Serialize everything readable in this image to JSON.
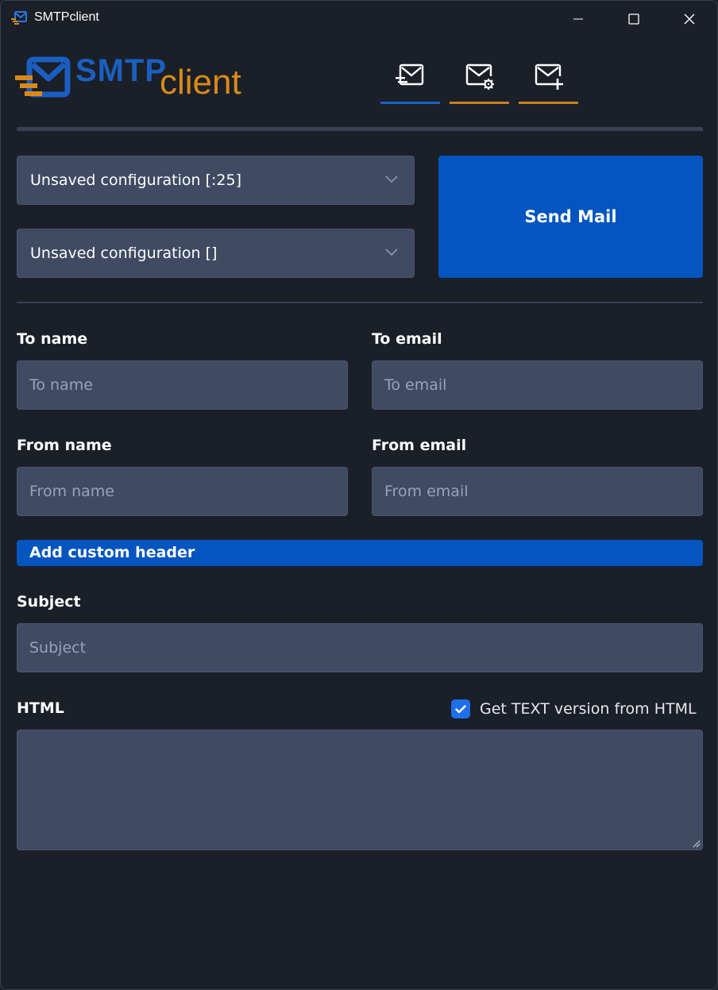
{
  "window": {
    "title": "SMTPclient"
  },
  "logo": {
    "part1": "SMTP",
    "part2": "client"
  },
  "nav": [
    {
      "name": "send-mail-icon",
      "active": true
    },
    {
      "name": "mail-settings-icon",
      "active": false
    },
    {
      "name": "mail-add-icon",
      "active": false
    }
  ],
  "config": {
    "select1": "Unsaved configuration [:25]",
    "select2": "Unsaved configuration []"
  },
  "actions": {
    "send_label": "Send Mail",
    "custom_header_label": "Add custom header"
  },
  "fields": {
    "to_name": {
      "label": "To name",
      "placeholder": "To name",
      "value": ""
    },
    "to_email": {
      "label": "To email",
      "placeholder": "To email",
      "value": ""
    },
    "from_name": {
      "label": "From name",
      "placeholder": "From name",
      "value": ""
    },
    "from_email": {
      "label": "From email",
      "placeholder": "From email",
      "value": ""
    },
    "subject": {
      "label": "Subject",
      "placeholder": "Subject",
      "value": ""
    },
    "html": {
      "label": "HTML",
      "value": ""
    }
  },
  "text_version": {
    "label": "Get TEXT version from HTML",
    "checked": true
  },
  "colors": {
    "background": "#1b1f28",
    "field": "#404a62",
    "accent_blue": "#0455bf",
    "accent_orange": "#c8801a"
  }
}
